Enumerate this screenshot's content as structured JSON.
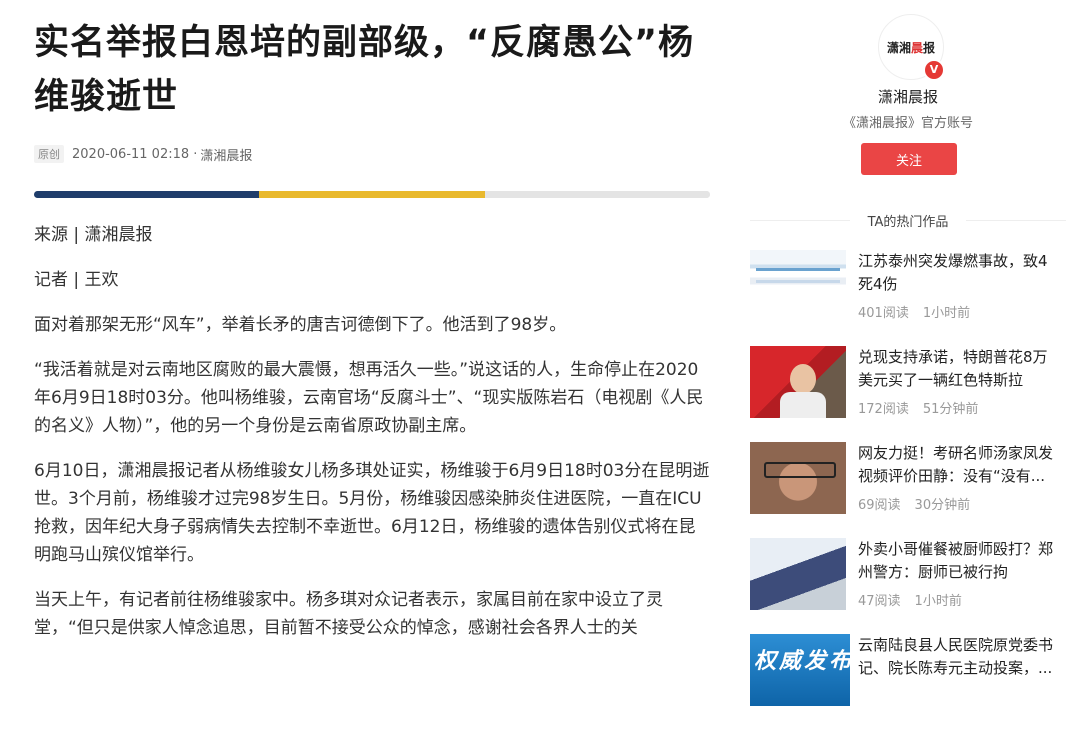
{
  "article": {
    "title": "实名举报白恩培的副部级，“反腐愚公”杨维骏逝世",
    "badge": "原创",
    "date": "2020-06-11 02:18 ·",
    "source": "潇湘晨报",
    "paragraphs": [
      "来源 | 潇湘晨报",
      "记者 | 王欢",
      "面对着那架无形“风车”，举着长矛的唐吉诃德倒下了。他活到了98岁。",
      "“我活着就是对云南地区腐败的最大震慑，想再活久一些。”说这话的人，生命停止在2020年6月9日18时03分。他叫杨维骏，云南官场“反腐斗士”、“现实版陈岩石（电视剧《人民的名义》人物）”，他的另一个身份是云南省原政协副主席。",
      "6月10日，潇湘晨报记者从杨维骏女儿杨多琪处证实，杨维骏于6月9日18时03分在昆明逝世。3个月前，杨维骏才过完98岁生日。5月份，杨维骏因感染肺炎住进医院，一直在ICU抢救，因年纪大身子弱病情失去控制不幸逝世。6月12日，杨维骏的遗体告别仪式将在昆明跑马山殡仪馆举行。",
      "当天上午，有记者前往杨维骏家中。杨多琪对众记者表示，家属目前在家中设立了灵堂，“但只是供家人悼念追思，目前暂不接受公众的悼念，感谢社会各界人士的关"
    ]
  },
  "sidebar": {
    "avatar_text_left": "潇湘",
    "avatar_text_mid": "晨",
    "avatar_text_right": "报",
    "verify_mark": "V",
    "account_name": "潇湘晨报",
    "account_desc": "《潇湘晨报》官方账号",
    "follow_label": "关注",
    "hot_header": "TA的热门作品",
    "hot_items": [
      {
        "title": "江苏泰州突发爆燃事故，致4死4伤",
        "reads": "401阅读",
        "time": "1小时前"
      },
      {
        "title": "兑现支持承诺，特朗普花8万美元买了一辆红色特斯拉",
        "reads": "172阅读",
        "time": "51分钟前"
      },
      {
        "title": "网友力挺！考研名师汤家凤发视频评价田静：没有“没有...",
        "reads": "69阅读",
        "time": "30分钟前"
      },
      {
        "title": "外卖小哥催餐被厨师殴打？郑州警方：厨师已被行拘",
        "reads": "47阅读",
        "time": "1小时前"
      },
      {
        "title": "云南陆良县人民医院原党委书记、院长陈寿元主动投案，...",
        "reads": "",
        "time": "",
        "thumb_text": "权威发布"
      }
    ]
  },
  "colors": {
    "follow_button": "#ea4545",
    "divider_dark": "#1f3d6b",
    "divider_gold": "#e9b92e"
  }
}
